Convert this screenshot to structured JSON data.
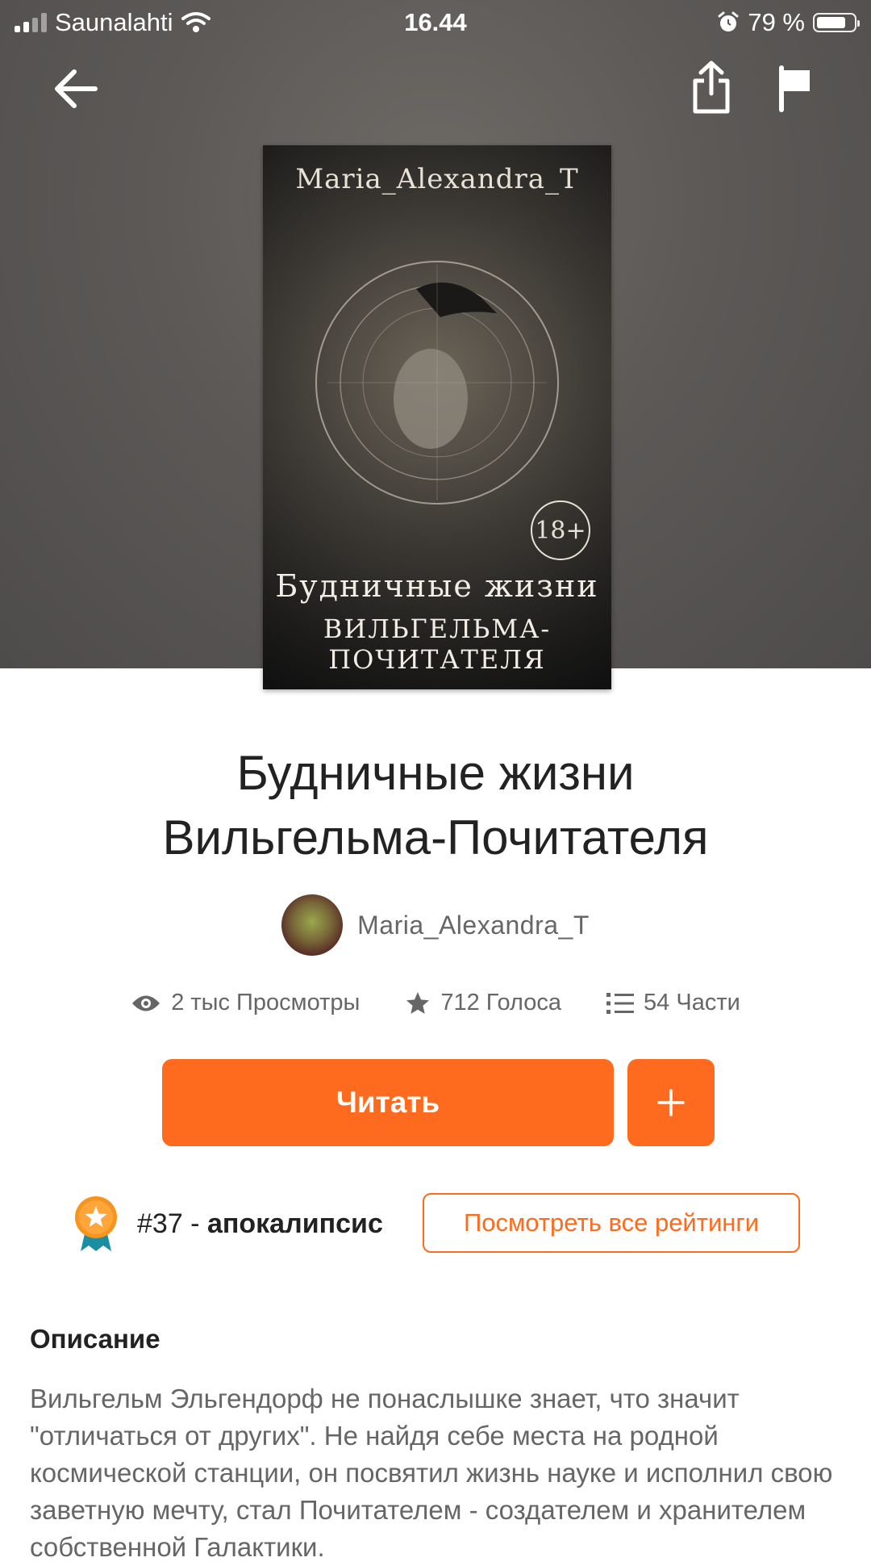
{
  "status_bar": {
    "carrier": "Saunalahti",
    "time": "16.44",
    "battery_percent": "79 %",
    "battery_level": 0.79
  },
  "cover": {
    "author_text": "Maria_Alexandra_T",
    "age_rating": "18+",
    "title_line1": "Будничные жизни",
    "title_line2": "ВИЛЬГЕЛЬМА-ПОЧИТАТЕЛЯ"
  },
  "story": {
    "title_line1": "Будничные жизни",
    "title_line2": "Вильгельма-Почитателя",
    "author": "Maria_Alexandra_T"
  },
  "stats": {
    "views": "2 тыс Просмотры",
    "votes": "712 Голоса",
    "parts": "54 Части"
  },
  "actions": {
    "read_label": "Читать",
    "add_label": "+"
  },
  "ranking": {
    "rank": "#37 -",
    "tag": "апокалипсис",
    "view_all_label": "Посмотреть все рейтинги"
  },
  "description": {
    "heading": "Описание",
    "text": "Вильгельм Эльгендорф не понаслышке знает, что значит \"отличаться от других\". Не найдя себе места на родной космической станции, он посвятил жизнь науке и исполнил свою заветную мечту, стал Почитателем - создателем и хранителем собственной Галактики."
  },
  "colors": {
    "accent": "#ff6b1e",
    "hero_bg": "#5c5957",
    "text_primary": "#222222",
    "text_secondary": "#666666"
  },
  "icons": [
    "back-arrow-icon",
    "share-icon",
    "flag-icon",
    "eye-icon",
    "star-icon",
    "list-icon",
    "plus-icon",
    "ribbon-star-icon",
    "wifi-icon",
    "alarm-icon"
  ]
}
